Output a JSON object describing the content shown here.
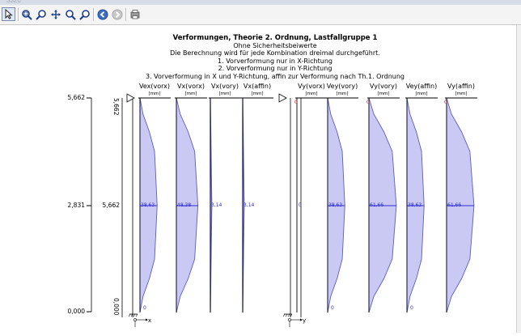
{
  "window": {
    "title": "3320"
  },
  "toolbar": {
    "buttons": [
      {
        "name": "pointer-tool-button",
        "icon": "arrow-pointer-icon"
      },
      {
        "name": "zoom-window-button",
        "icon": "zoom-window-icon"
      },
      {
        "name": "zoom-button",
        "icon": "magnifier-icon"
      },
      {
        "name": "pan-button",
        "icon": "move-arrows-icon"
      },
      {
        "name": "zoom-in-button",
        "icon": "zoom-in-icon"
      },
      {
        "name": "zoom-out-button",
        "icon": "zoom-out-icon"
      },
      {
        "name": "back-button",
        "icon": "back-arrow-icon"
      },
      {
        "name": "forward-button",
        "icon": "forward-arrow-icon"
      },
      {
        "name": "print-button",
        "icon": "print-icon"
      }
    ]
  },
  "header": {
    "title": "Verformungen, Theorie 2. Ordnung, Lastfallgruppe 1",
    "lines": [
      "Ohne Sicherheitsbeiwerte",
      "Die Berechnung wird für jede Kombination dreimal durchgeführt.",
      "1. Vorverformung nur in X-Richtung",
      "2. Vorverformung nur in Y-Richtung",
      "3. Vorverformung in X und Y-Richtung, affin zur Verformung nach Th.1. Ordnung"
    ]
  },
  "colors": {
    "fill": "#c9c9f4",
    "line": "#5a5ad6",
    "text_blue": "#2a2ad0",
    "text_red": "#d01818"
  },
  "axis": {
    "left_labels": [
      "5,662",
      "2,831",
      "0,000"
    ],
    "left_labels2": [
      "5,662"
    ],
    "rotated_top": "5,662",
    "rotated_bottom": "0,000",
    "axis_x": "x",
    "axis_y": "y"
  },
  "group_x": [
    {
      "name": "Vex(vorx)",
      "unit": "[mm]",
      "value": "38,63",
      "max": 38.63,
      "shape": "arc",
      "bottom_label": "0"
    },
    {
      "name": "Vx(vorx)",
      "unit": "[mm]",
      "value": "48,38",
      "max": 48.38,
      "shape": "arc",
      "bottom_label": ""
    },
    {
      "name": "Vx(vory)",
      "unit": "[mm]",
      "value": "3,14",
      "max": 3.14,
      "shape": "line",
      "bottom_label": ""
    },
    {
      "name": "Vx(affin)",
      "unit": "[mm]",
      "value": "3,14",
      "max": 3.14,
      "shape": "line",
      "bottom_label": ""
    }
  ],
  "group_y": [
    {
      "name": "Vy(vorx)",
      "unit": "[mm]",
      "value": "0",
      "top_label": "0",
      "max": 0,
      "shape": "none",
      "bottom_label": ""
    },
    {
      "name": "Vey(vory)",
      "unit": "[mm]",
      "value": "38,63",
      "top_label": "",
      "max": 38.63,
      "shape": "arc",
      "bottom_label": "0"
    },
    {
      "name": "Vy(vory)",
      "unit": "[mm]",
      "value": "61,66",
      "top_label": "0",
      "max": 61.66,
      "shape": "arc",
      "bottom_label": ""
    },
    {
      "name": "Vey(affin)",
      "unit": "[mm]",
      "value": "38,63",
      "top_label": "",
      "max": 38.63,
      "shape": "arc",
      "bottom_label": "0"
    },
    {
      "name": "Vy(affin)",
      "unit": "[mm]",
      "value": "61,66",
      "top_label": "0",
      "max": 61.66,
      "shape": "arc",
      "bottom_label": ""
    }
  ]
}
